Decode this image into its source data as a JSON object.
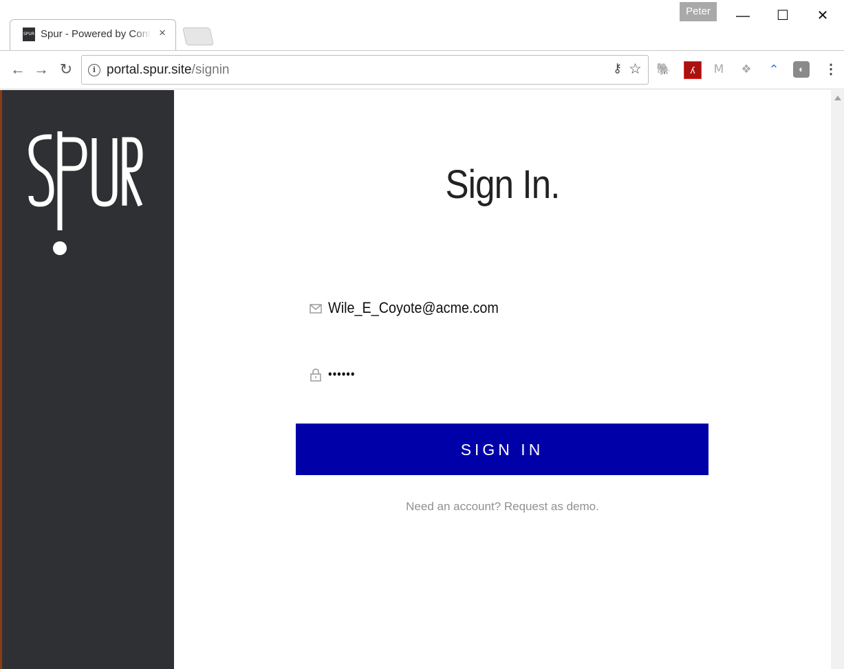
{
  "browser": {
    "tab_title": "Spur - Powered by Continuum",
    "tab_favicon_text": "SPUR",
    "tab_close": "×",
    "profile_name": "Peter",
    "window_minimize": "—",
    "window_maximize": "☐",
    "window_close": "✕",
    "back": "←",
    "forward": "→",
    "reload": "↻",
    "url_host": "portal.spur.site",
    "url_path": "/signin",
    "info_icon": "i",
    "key_icon": "⚷",
    "star_icon": "☆",
    "extensions": {
      "evernote": "🐘",
      "pdf": "ʎ",
      "mail": "M",
      "dropbox": "❖",
      "arc": "⌃",
      "box": "◐",
      "menu": "⋮"
    }
  },
  "sidebar": {
    "logo_text": "SPUR"
  },
  "signin": {
    "heading": "Sign In.",
    "email_value": "Wile_E_Coyote@acme.com",
    "password_value": "••••••",
    "button_label": "SIGN IN",
    "request_text": "Need an account? Request as demo."
  },
  "colors": {
    "sidebar": "#2f3033",
    "button": "#0000a8",
    "link": "#909090"
  }
}
